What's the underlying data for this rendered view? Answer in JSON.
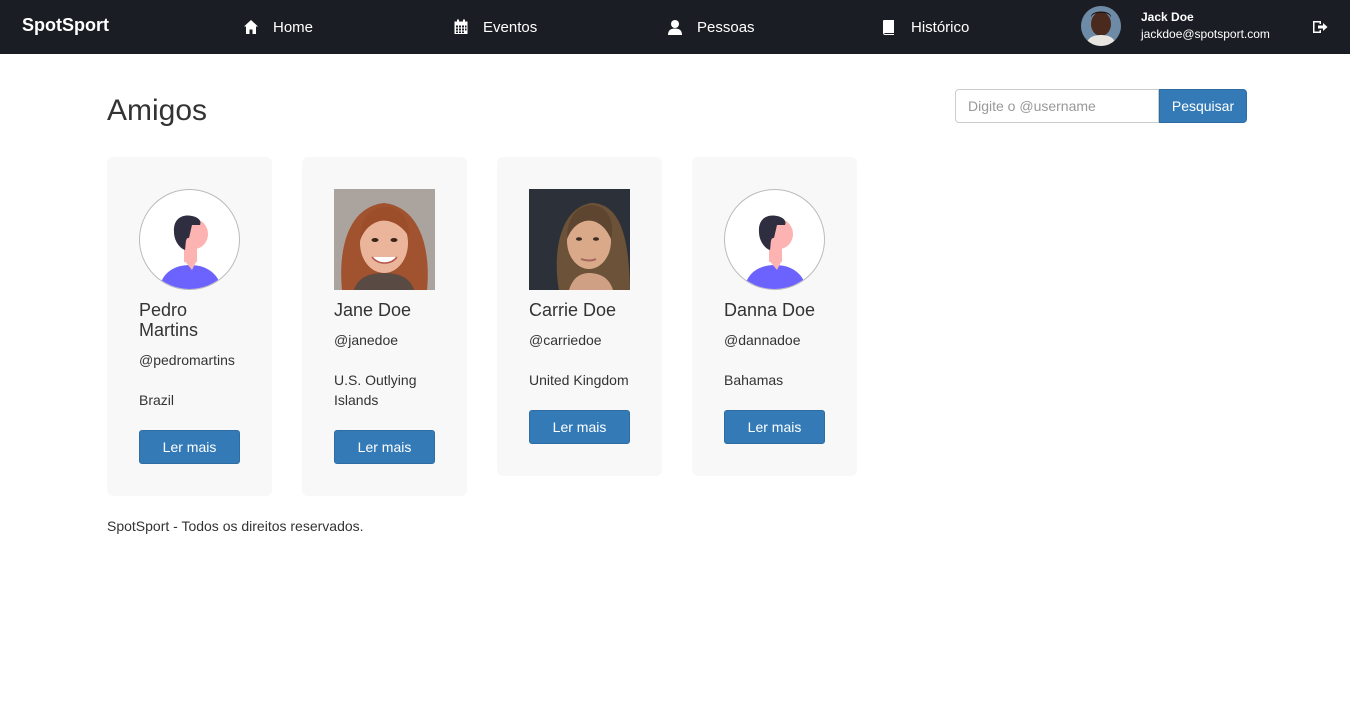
{
  "navbar": {
    "brand": "SpotSport",
    "items": [
      {
        "label": "Home",
        "icon": "home-icon"
      },
      {
        "label": "Eventos",
        "icon": "calendar-icon"
      },
      {
        "label": "Pessoas",
        "icon": "user-icon"
      },
      {
        "label": "Histórico",
        "icon": "book-icon"
      }
    ],
    "user": {
      "name": "Jack Doe",
      "email": "jackdoe@spotsport.com"
    },
    "logout_icon": "logout-icon"
  },
  "page": {
    "title": "Amigos"
  },
  "search": {
    "placeholder": "Digite o @username",
    "value": "",
    "button_label": "Pesquisar"
  },
  "friends": [
    {
      "name": "Pedro Martins",
      "username": "@pedromartins",
      "country": "Brazil",
      "button_label": "Ler mais",
      "photo": "default-avatar-icon"
    },
    {
      "name": "Jane Doe",
      "username": "@janedoe",
      "country": "U.S. Outlying Islands",
      "button_label": "Ler mais",
      "photo": "profile-photo"
    },
    {
      "name": "Carrie Doe",
      "username": "@carriedoe",
      "country": "United Kingdom",
      "button_label": "Ler mais",
      "photo": "profile-photo"
    },
    {
      "name": "Danna Doe",
      "username": "@dannadoe",
      "country": "Bahamas",
      "button_label": "Ler mais",
      "photo": "default-avatar-icon"
    }
  ],
  "footer": {
    "text": "SpotSport - Todos os direitos reservados."
  },
  "colors": {
    "navbar_bg": "#1a1d24",
    "primary": "#337ab7",
    "card_bg": "#f8f8f8",
    "avatar_shirt": "#6c63ff"
  }
}
